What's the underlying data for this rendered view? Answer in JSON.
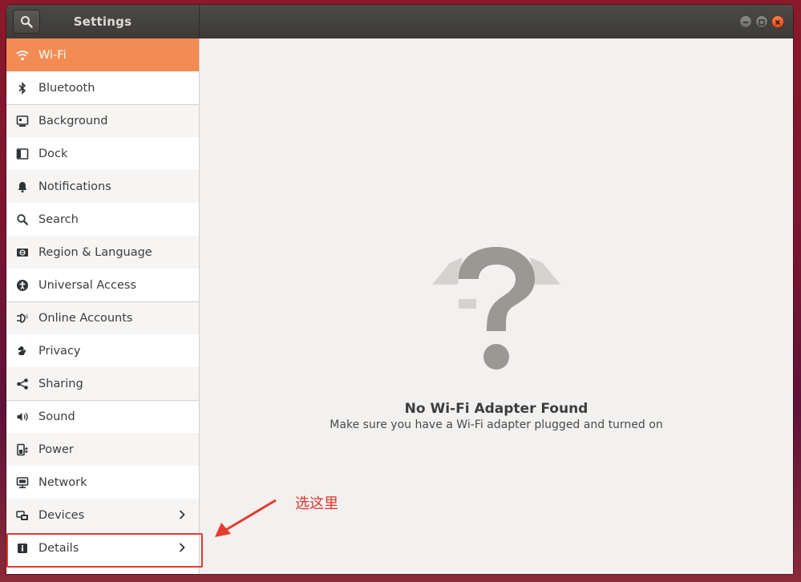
{
  "window": {
    "title": "Settings"
  },
  "sidebar": {
    "items": [
      {
        "label": "Wi-Fi",
        "icon": "wifi-icon"
      },
      {
        "label": "Bluetooth",
        "icon": "bluetooth-icon"
      },
      {
        "label": "Background",
        "icon": "background-icon"
      },
      {
        "label": "Dock",
        "icon": "dock-icon"
      },
      {
        "label": "Notifications",
        "icon": "bell-icon"
      },
      {
        "label": "Search",
        "icon": "search-icon"
      },
      {
        "label": "Region & Language",
        "icon": "region-icon"
      },
      {
        "label": "Universal Access",
        "icon": "universal-access-icon"
      },
      {
        "label": "Online Accounts",
        "icon": "online-accounts-icon"
      },
      {
        "label": "Privacy",
        "icon": "hand-icon"
      },
      {
        "label": "Sharing",
        "icon": "share-icon"
      },
      {
        "label": "Sound",
        "icon": "speaker-icon"
      },
      {
        "label": "Power",
        "icon": "power-plug-icon"
      },
      {
        "label": "Network",
        "icon": "network-icon"
      },
      {
        "label": "Devices",
        "icon": "devices-icon"
      },
      {
        "label": "Details",
        "icon": "info-icon"
      }
    ]
  },
  "main": {
    "empty_title": "No Wi-Fi Adapter Found",
    "empty_description": "Make sure you have a Wi-Fi adapter plugged and turned on"
  },
  "annotation": {
    "text": "选这里"
  },
  "colors": {
    "accent": "#f38b54",
    "annotation_red": "#e53b2e"
  }
}
